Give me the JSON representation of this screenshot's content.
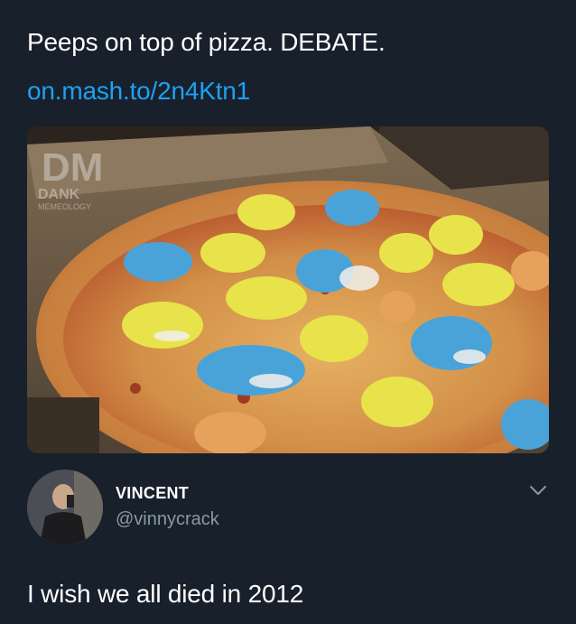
{
  "tweet": {
    "text": "Peeps on top of pizza. DEBATE.",
    "link": "on.mash.to/2n4Ktn1",
    "media": {
      "watermark_mark": "DM",
      "watermark_top": "DANK",
      "watermark_bottom": "MEMEOLOGY"
    }
  },
  "author": {
    "name": "VINCENT",
    "handle": "@vinnycrack",
    "avatar_icon": "avatar-photo",
    "menu_icon": "chevron-down-icon"
  },
  "reply": {
    "text": "I wish we all died in 2012"
  },
  "colors": {
    "background": "#18202c",
    "link": "#1da1f2",
    "handle": "#8899a6",
    "peep_yellow": "#e8e34a",
    "peep_blue": "#4aa3d8"
  }
}
